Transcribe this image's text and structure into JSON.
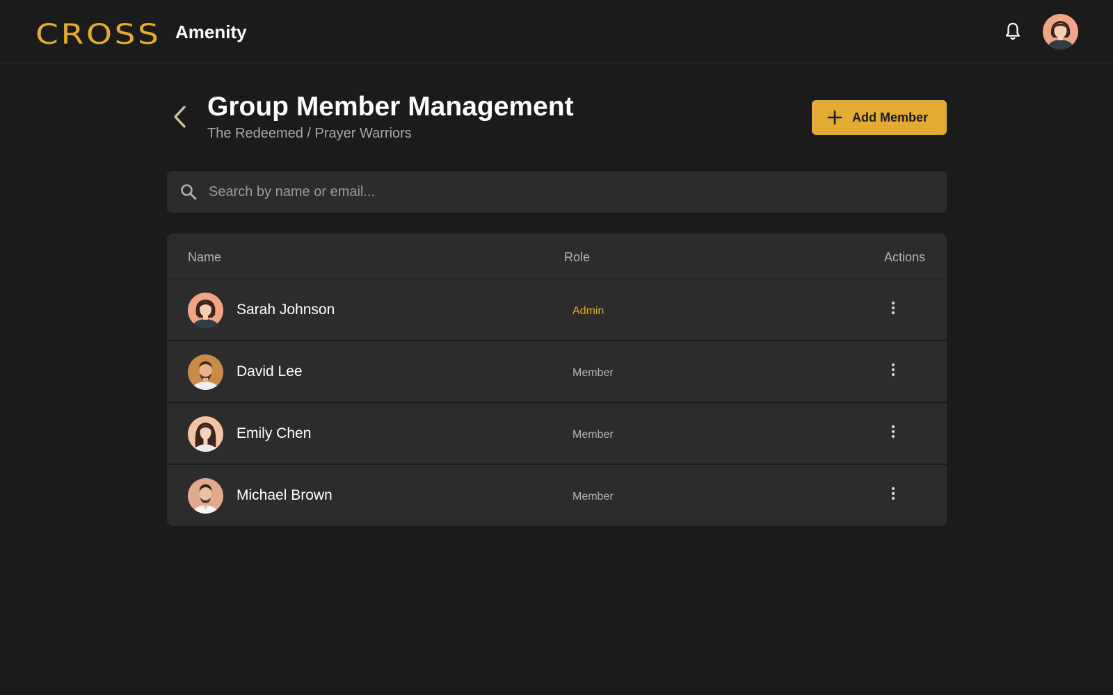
{
  "header": {
    "logo": "CROSS",
    "app_name": "Amenity",
    "notification_icon": "bell-icon",
    "user_avatar": "user-avatar"
  },
  "page": {
    "title": "Group Member Management",
    "breadcrumb": "The Redeemed / Prayer Warriors",
    "add_button_label": "Add Member"
  },
  "search": {
    "placeholder": "Search by name or email...",
    "value": ""
  },
  "table": {
    "headers": {
      "name": "Name",
      "role": "Role",
      "actions": "Actions"
    },
    "rows": [
      {
        "name": "Sarah Johnson",
        "role": "Admin"
      },
      {
        "name": "David Lee",
        "role": "Member"
      },
      {
        "name": "Emily Chen",
        "role": "Member"
      },
      {
        "name": "Michael Brown",
        "role": "Member"
      }
    ]
  },
  "colors": {
    "accent": "#e3ab31",
    "background": "#1b1b1b",
    "surface": "#2c2c2c"
  }
}
